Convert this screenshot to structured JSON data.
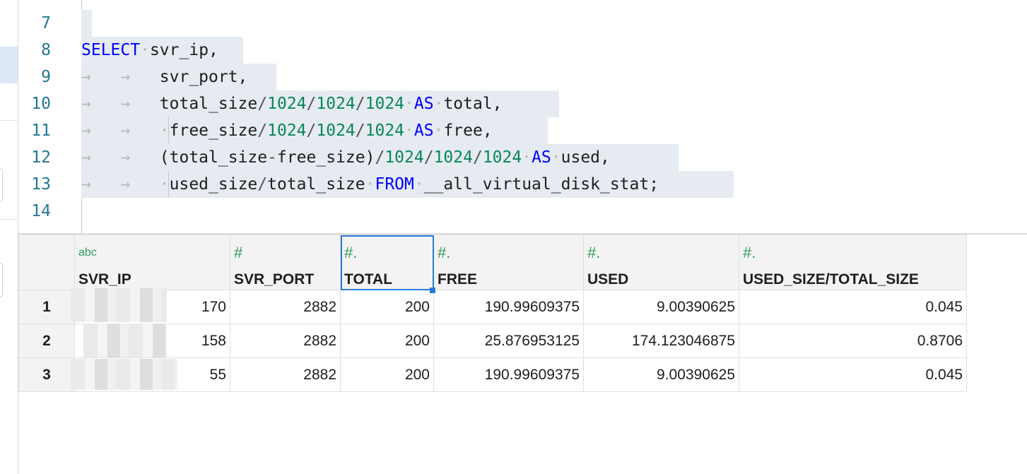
{
  "editor": {
    "lines": [
      {
        "num": "7"
      },
      {
        "num": "8"
      },
      {
        "num": "9"
      },
      {
        "num": "10"
      },
      {
        "num": "11"
      },
      {
        "num": "12"
      },
      {
        "num": "13"
      },
      {
        "num": "14"
      }
    ],
    "tokens": {
      "select_kw": "SELECT",
      "svr_ip": "svr_ip,",
      "svr_port": "svr_port,",
      "total_size": "total_size",
      "slash": "/",
      "n1024": "1024",
      "as_kw": "AS",
      "total_alias": "total,",
      "free_size": "free_size",
      "free_alias": "free,",
      "paren_open": "(total_size",
      "minus": "-",
      "free_size_close": "free_size)",
      "used_alias": "used,",
      "used_size": "used_size",
      "total_size2": "total_size",
      "from_kw": "FROM",
      "table_name": "__all_virtual_disk_stat;"
    }
  },
  "results": {
    "columns": [
      {
        "type": "abc",
        "name": "SVR_IP"
      },
      {
        "type": "#",
        "name": "SVR_PORT"
      },
      {
        "type": "#.",
        "name": "TOTAL"
      },
      {
        "type": "#.",
        "name": "FREE"
      },
      {
        "type": "#.",
        "name": "USED"
      },
      {
        "type": "#.",
        "name": "USED_SIZE/TOTAL_SIZE"
      }
    ],
    "rows": [
      {
        "num": "1",
        "svr_ip": "170",
        "svr_port": "2882",
        "total": "200",
        "free": "190.99609375",
        "used": "9.00390625",
        "ratio": "0.045"
      },
      {
        "num": "2",
        "svr_ip": "158",
        "svr_port": "2882",
        "total": "200",
        "free": "25.876953125",
        "used": "174.123046875",
        "ratio": "0.8706"
      },
      {
        "num": "3",
        "svr_ip": "55",
        "svr_port": "2882",
        "total": "200",
        "free": "190.99609375",
        "used": "9.00390625",
        "ratio": "0.045"
      }
    ]
  },
  "colors": {
    "keyword": "#0000ff",
    "number": "#098658",
    "line_number": "#237893",
    "selection": "#e5ebf1",
    "type_icon": "#2e9e5c",
    "active_cell_border": "#2a7ad8"
  }
}
